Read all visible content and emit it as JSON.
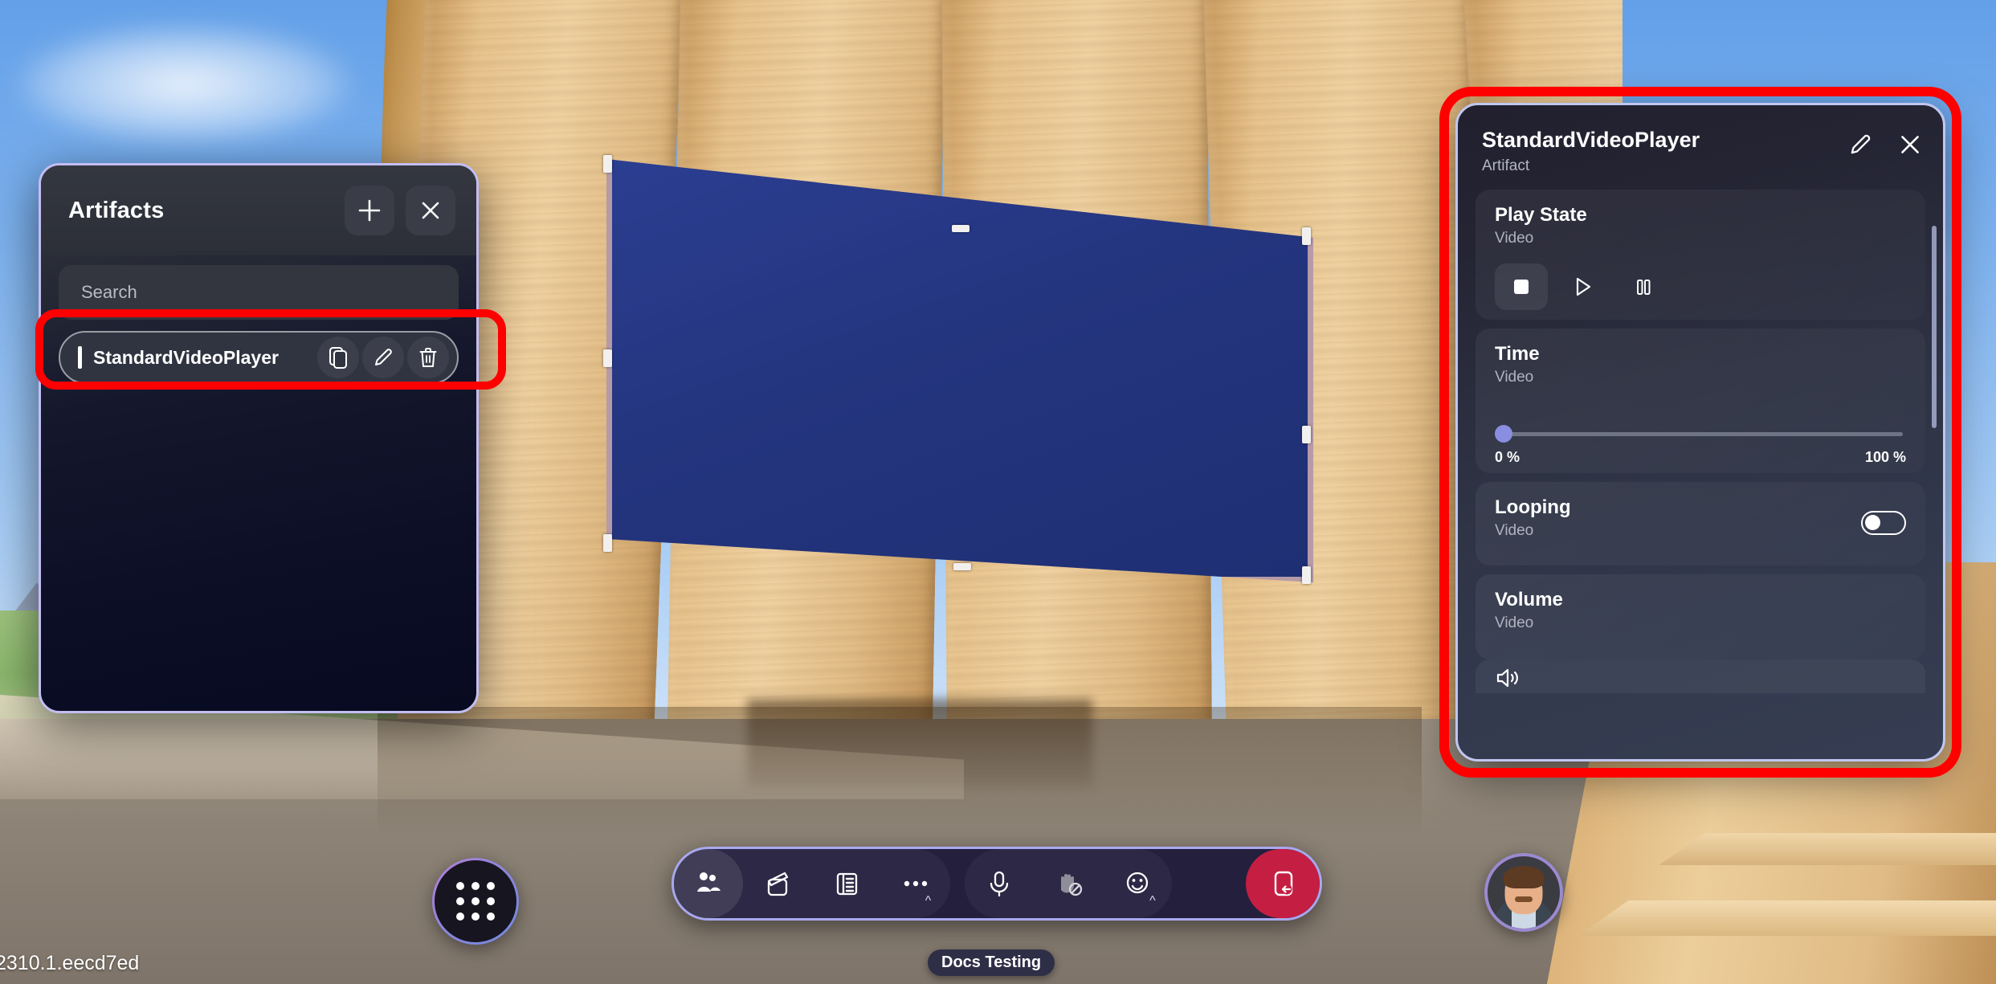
{
  "artifacts_panel": {
    "title": "Artifacts",
    "add_button_label": "+",
    "close_button_label": "×",
    "search_placeholder": "Search",
    "items": [
      {
        "name": "StandardVideoPlayer",
        "actions": [
          "duplicate-icon",
          "edit-icon",
          "delete-icon"
        ]
      }
    ]
  },
  "properties_panel": {
    "title": "StandardVideoPlayer",
    "subtitle": "Artifact",
    "header_actions": [
      "edit-icon",
      "close-icon"
    ],
    "properties": [
      {
        "label": "Play State",
        "sub": "Video",
        "type": "transport",
        "buttons": [
          "stop-icon",
          "play-icon",
          "pause-icon"
        ],
        "selected": "stop-icon"
      },
      {
        "label": "Time",
        "sub": "Video",
        "type": "slider",
        "value": 0,
        "min_label": "0 %",
        "max_label": "100 %"
      },
      {
        "label": "Looping",
        "sub": "Video",
        "type": "toggle",
        "value": false
      },
      {
        "label": "Volume",
        "sub": "Video",
        "type": "slider",
        "icon": "speaker-icon"
      }
    ]
  },
  "toolbar": {
    "launcher_label": "app-grid",
    "buttons": [
      {
        "name": "people-icon",
        "active": true
      },
      {
        "name": "media-clapperboard-icon",
        "active": false
      },
      {
        "name": "notes-panel-icon",
        "active": false
      },
      {
        "name": "more-options-icon",
        "active": false,
        "caret": "^"
      },
      {
        "name": "microphone-icon",
        "active": false
      },
      {
        "name": "raise-hand-disabled-icon",
        "active": false
      },
      {
        "name": "reactions-smiley-icon",
        "active": false,
        "caret": "^"
      }
    ],
    "leave_button": "leave-call-icon"
  },
  "tooltip": {
    "text": "Docs Testing"
  },
  "version": {
    "text": "2310.1.eecd7ed"
  },
  "avatar": {
    "name": "user-avatar"
  },
  "colors": {
    "accent_purple": "#8a8ee0",
    "panel_border": "#bfc6f0",
    "highlight_red": "#ff0000",
    "leave_red": "#c51e43",
    "board_blue": "#24357f"
  }
}
